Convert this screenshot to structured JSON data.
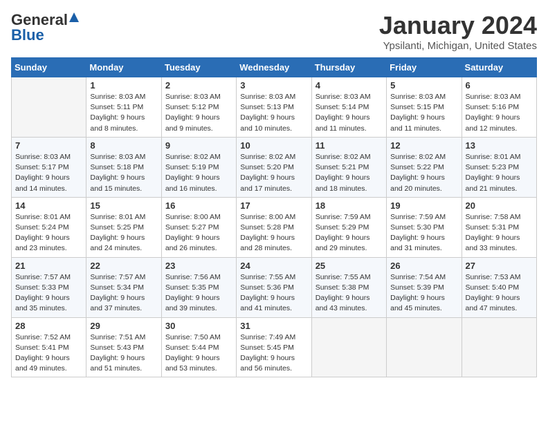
{
  "header": {
    "logo_general": "General",
    "logo_blue": "Blue",
    "month": "January 2024",
    "location": "Ypsilanti, Michigan, United States"
  },
  "weekdays": [
    "Sunday",
    "Monday",
    "Tuesday",
    "Wednesday",
    "Thursday",
    "Friday",
    "Saturday"
  ],
  "weeks": [
    [
      {
        "day": "",
        "sunrise": "",
        "sunset": "",
        "daylight": ""
      },
      {
        "day": "1",
        "sunrise": "Sunrise: 8:03 AM",
        "sunset": "Sunset: 5:11 PM",
        "daylight": "Daylight: 9 hours and 8 minutes."
      },
      {
        "day": "2",
        "sunrise": "Sunrise: 8:03 AM",
        "sunset": "Sunset: 5:12 PM",
        "daylight": "Daylight: 9 hours and 9 minutes."
      },
      {
        "day": "3",
        "sunrise": "Sunrise: 8:03 AM",
        "sunset": "Sunset: 5:13 PM",
        "daylight": "Daylight: 9 hours and 10 minutes."
      },
      {
        "day": "4",
        "sunrise": "Sunrise: 8:03 AM",
        "sunset": "Sunset: 5:14 PM",
        "daylight": "Daylight: 9 hours and 11 minutes."
      },
      {
        "day": "5",
        "sunrise": "Sunrise: 8:03 AM",
        "sunset": "Sunset: 5:15 PM",
        "daylight": "Daylight: 9 hours and 11 minutes."
      },
      {
        "day": "6",
        "sunrise": "Sunrise: 8:03 AM",
        "sunset": "Sunset: 5:16 PM",
        "daylight": "Daylight: 9 hours and 12 minutes."
      }
    ],
    [
      {
        "day": "7",
        "sunrise": "Sunrise: 8:03 AM",
        "sunset": "Sunset: 5:17 PM",
        "daylight": "Daylight: 9 hours and 14 minutes."
      },
      {
        "day": "8",
        "sunrise": "Sunrise: 8:03 AM",
        "sunset": "Sunset: 5:18 PM",
        "daylight": "Daylight: 9 hours and 15 minutes."
      },
      {
        "day": "9",
        "sunrise": "Sunrise: 8:02 AM",
        "sunset": "Sunset: 5:19 PM",
        "daylight": "Daylight: 9 hours and 16 minutes."
      },
      {
        "day": "10",
        "sunrise": "Sunrise: 8:02 AM",
        "sunset": "Sunset: 5:20 PM",
        "daylight": "Daylight: 9 hours and 17 minutes."
      },
      {
        "day": "11",
        "sunrise": "Sunrise: 8:02 AM",
        "sunset": "Sunset: 5:21 PM",
        "daylight": "Daylight: 9 hours and 18 minutes."
      },
      {
        "day": "12",
        "sunrise": "Sunrise: 8:02 AM",
        "sunset": "Sunset: 5:22 PM",
        "daylight": "Daylight: 9 hours and 20 minutes."
      },
      {
        "day": "13",
        "sunrise": "Sunrise: 8:01 AM",
        "sunset": "Sunset: 5:23 PM",
        "daylight": "Daylight: 9 hours and 21 minutes."
      }
    ],
    [
      {
        "day": "14",
        "sunrise": "Sunrise: 8:01 AM",
        "sunset": "Sunset: 5:24 PM",
        "daylight": "Daylight: 9 hours and 23 minutes."
      },
      {
        "day": "15",
        "sunrise": "Sunrise: 8:01 AM",
        "sunset": "Sunset: 5:25 PM",
        "daylight": "Daylight: 9 hours and 24 minutes."
      },
      {
        "day": "16",
        "sunrise": "Sunrise: 8:00 AM",
        "sunset": "Sunset: 5:27 PM",
        "daylight": "Daylight: 9 hours and 26 minutes."
      },
      {
        "day": "17",
        "sunrise": "Sunrise: 8:00 AM",
        "sunset": "Sunset: 5:28 PM",
        "daylight": "Daylight: 9 hours and 28 minutes."
      },
      {
        "day": "18",
        "sunrise": "Sunrise: 7:59 AM",
        "sunset": "Sunset: 5:29 PM",
        "daylight": "Daylight: 9 hours and 29 minutes."
      },
      {
        "day": "19",
        "sunrise": "Sunrise: 7:59 AM",
        "sunset": "Sunset: 5:30 PM",
        "daylight": "Daylight: 9 hours and 31 minutes."
      },
      {
        "day": "20",
        "sunrise": "Sunrise: 7:58 AM",
        "sunset": "Sunset: 5:31 PM",
        "daylight": "Daylight: 9 hours and 33 minutes."
      }
    ],
    [
      {
        "day": "21",
        "sunrise": "Sunrise: 7:57 AM",
        "sunset": "Sunset: 5:33 PM",
        "daylight": "Daylight: 9 hours and 35 minutes."
      },
      {
        "day": "22",
        "sunrise": "Sunrise: 7:57 AM",
        "sunset": "Sunset: 5:34 PM",
        "daylight": "Daylight: 9 hours and 37 minutes."
      },
      {
        "day": "23",
        "sunrise": "Sunrise: 7:56 AM",
        "sunset": "Sunset: 5:35 PM",
        "daylight": "Daylight: 9 hours and 39 minutes."
      },
      {
        "day": "24",
        "sunrise": "Sunrise: 7:55 AM",
        "sunset": "Sunset: 5:36 PM",
        "daylight": "Daylight: 9 hours and 41 minutes."
      },
      {
        "day": "25",
        "sunrise": "Sunrise: 7:55 AM",
        "sunset": "Sunset: 5:38 PM",
        "daylight": "Daylight: 9 hours and 43 minutes."
      },
      {
        "day": "26",
        "sunrise": "Sunrise: 7:54 AM",
        "sunset": "Sunset: 5:39 PM",
        "daylight": "Daylight: 9 hours and 45 minutes."
      },
      {
        "day": "27",
        "sunrise": "Sunrise: 7:53 AM",
        "sunset": "Sunset: 5:40 PM",
        "daylight": "Daylight: 9 hours and 47 minutes."
      }
    ],
    [
      {
        "day": "28",
        "sunrise": "Sunrise: 7:52 AM",
        "sunset": "Sunset: 5:41 PM",
        "daylight": "Daylight: 9 hours and 49 minutes."
      },
      {
        "day": "29",
        "sunrise": "Sunrise: 7:51 AM",
        "sunset": "Sunset: 5:43 PM",
        "daylight": "Daylight: 9 hours and 51 minutes."
      },
      {
        "day": "30",
        "sunrise": "Sunrise: 7:50 AM",
        "sunset": "Sunset: 5:44 PM",
        "daylight": "Daylight: 9 hours and 53 minutes."
      },
      {
        "day": "31",
        "sunrise": "Sunrise: 7:49 AM",
        "sunset": "Sunset: 5:45 PM",
        "daylight": "Daylight: 9 hours and 56 minutes."
      },
      {
        "day": "",
        "sunrise": "",
        "sunset": "",
        "daylight": ""
      },
      {
        "day": "",
        "sunrise": "",
        "sunset": "",
        "daylight": ""
      },
      {
        "day": "",
        "sunrise": "",
        "sunset": "",
        "daylight": ""
      }
    ]
  ]
}
